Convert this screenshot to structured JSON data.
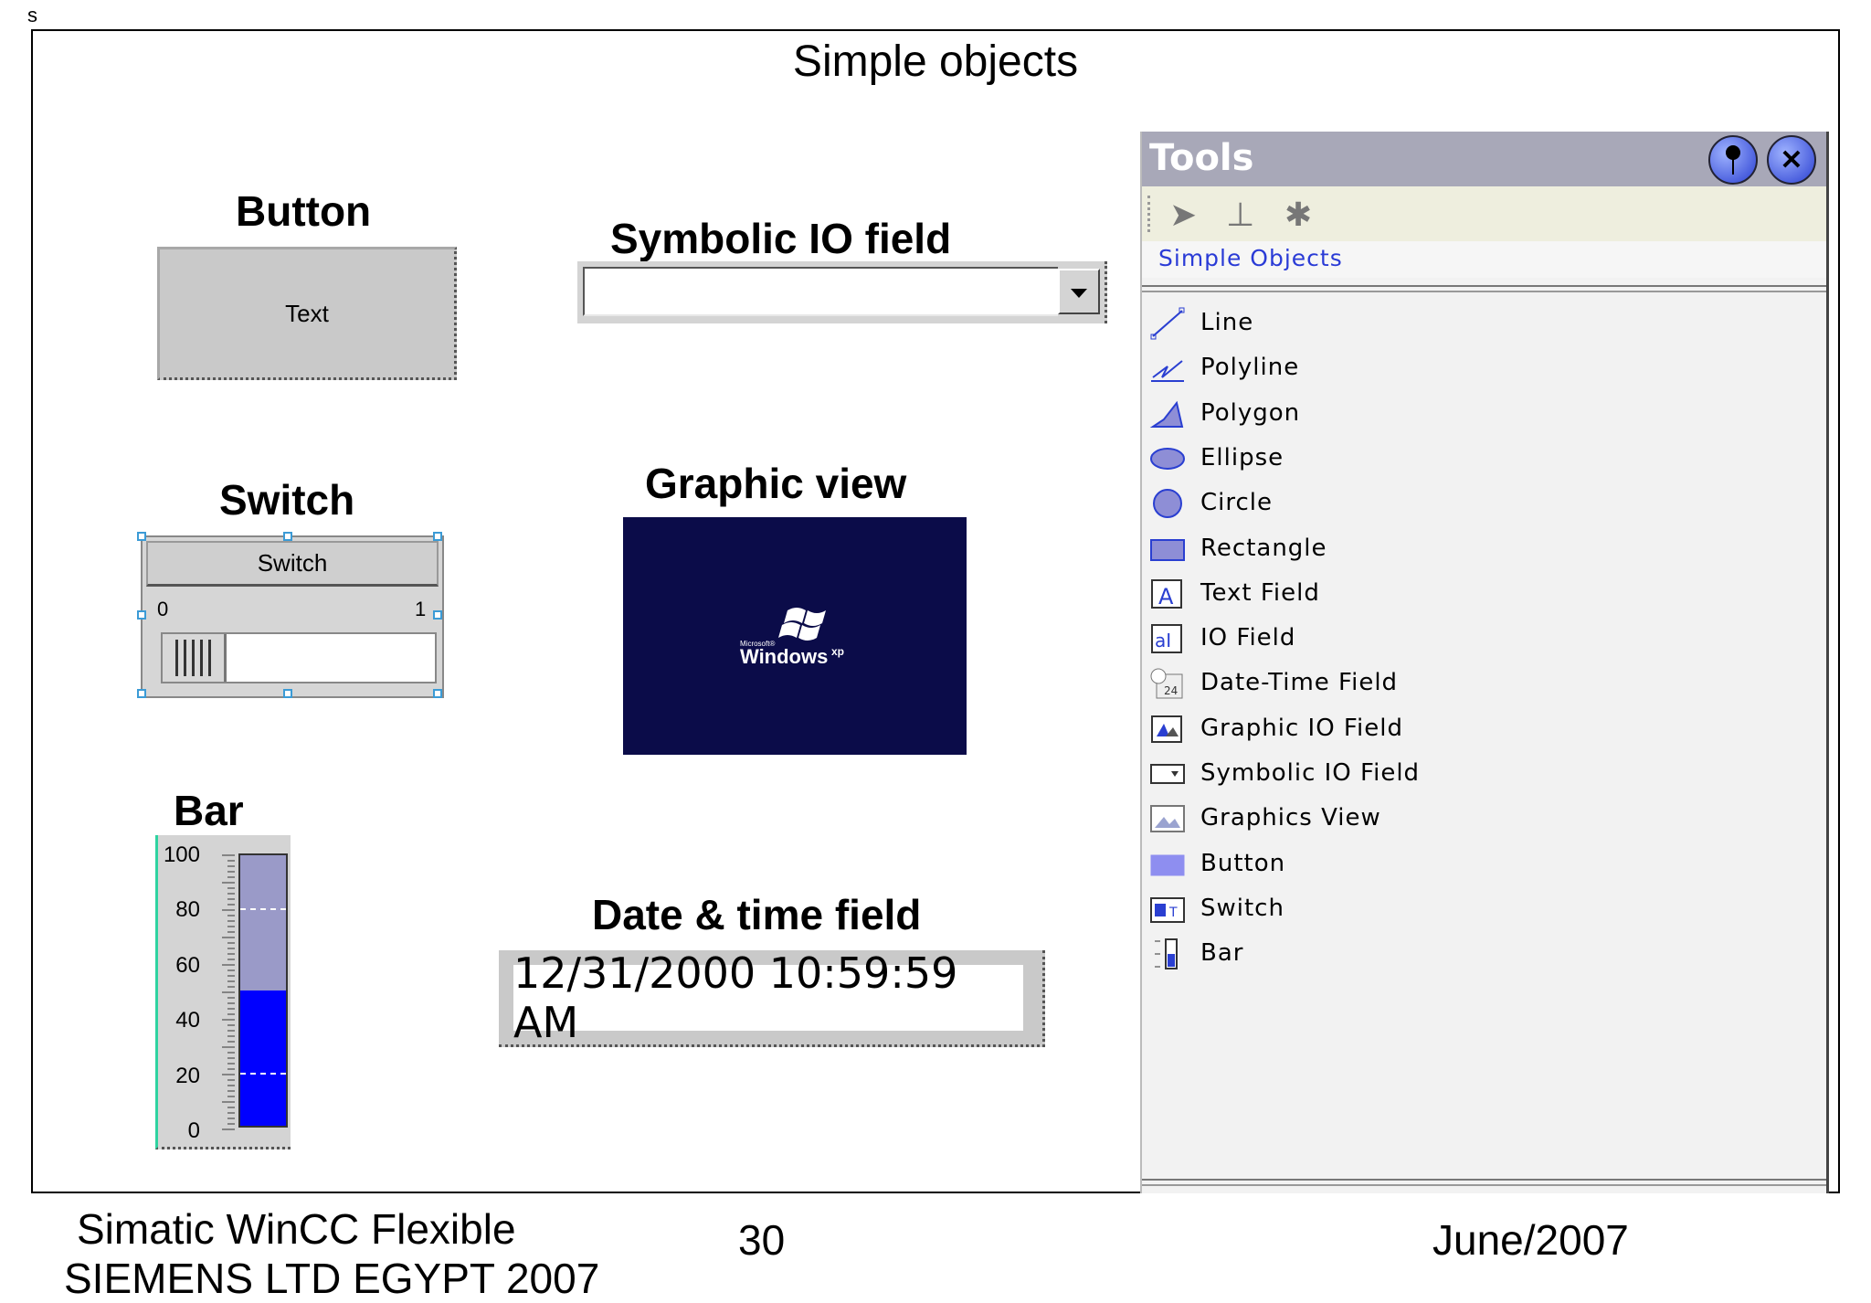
{
  "corner_mark": "s",
  "slide_title": "Simple objects",
  "button_section": {
    "heading": "Button",
    "button_text": "Text"
  },
  "symbolic_section": {
    "heading": "Symbolic IO field"
  },
  "switch_section": {
    "heading": "Switch",
    "header_text": "Switch",
    "min_label": "0",
    "max_label": "1"
  },
  "graphic_section": {
    "heading": "Graphic view",
    "ms_text": "Microsoft®",
    "win_text": "Windows",
    "xp_text": "xp"
  },
  "bar_section": {
    "heading": "Bar",
    "scale_labels": [
      "100",
      "80",
      "60",
      "40",
      "20",
      "0"
    ],
    "value": 50,
    "max": 100,
    "fill_color": "#0000ff",
    "background_color": "#9a9ac8"
  },
  "datetime_section": {
    "heading": "Date & time field",
    "value": "12/31/2000 10:59:59 AM"
  },
  "tools_panel": {
    "title": "Tools",
    "pin_icon": "pin-icon",
    "close_icon": "close-icon",
    "toolbar_icons": [
      "pointer-icon",
      "stamp-icon",
      "tools-icon"
    ],
    "section_label": "Simple Objects",
    "items": [
      {
        "label": "Line",
        "icon": "line-icon"
      },
      {
        "label": "Polyline",
        "icon": "polyline-icon"
      },
      {
        "label": "Polygon",
        "icon": "polygon-icon"
      },
      {
        "label": "Ellipse",
        "icon": "ellipse-icon"
      },
      {
        "label": "Circle",
        "icon": "circle-icon"
      },
      {
        "label": "Rectangle",
        "icon": "rectangle-icon"
      },
      {
        "label": "Text Field",
        "icon": "text-field-icon"
      },
      {
        "label": "IO Field",
        "icon": "io-field-icon"
      },
      {
        "label": "Date-Time Field",
        "icon": "date-time-field-icon"
      },
      {
        "label": "Graphic IO Field",
        "icon": "graphic-io-field-icon"
      },
      {
        "label": "Symbolic IO Field",
        "icon": "symbolic-io-field-icon"
      },
      {
        "label": "Graphics View",
        "icon": "graphics-view-icon"
      },
      {
        "label": "Button",
        "icon": "button-icon"
      },
      {
        "label": "Switch",
        "icon": "switch-icon"
      },
      {
        "label": "Bar",
        "icon": "bar-icon"
      }
    ]
  },
  "footer": {
    "product": "Simatic WinCC Flexible",
    "company": "SIEMENS LTD EGYPT 2007",
    "page_number": "30",
    "date": "June/2007"
  }
}
